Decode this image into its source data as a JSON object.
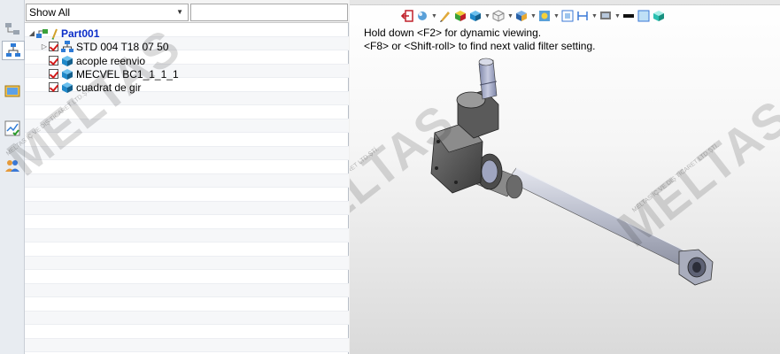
{
  "tree_panel": {
    "filter_select": "Show All",
    "filter_input": "",
    "root": {
      "label": "Part001",
      "expanded": true
    },
    "children": [
      {
        "label": "STD 004 T18 07 50",
        "checked": true,
        "icon": "assembly-icon",
        "has_children": true
      },
      {
        "label": "acople reenvio",
        "checked": true,
        "icon": "part-cube-icon",
        "has_children": false
      },
      {
        "label": "MECVEL BC1_1_1_1",
        "checked": true,
        "icon": "part-cube-icon",
        "has_children": false
      },
      {
        "label": "cuadrat de gir",
        "checked": true,
        "icon": "part-cube-icon",
        "has_children": false
      }
    ]
  },
  "viewport": {
    "hint_line_1": "Hold down <F2> for dynamic viewing.",
    "hint_line_2": "<F8> or <Shift-roll> to find next valid filter setting."
  },
  "left_strip": {
    "icons": [
      "structure-tree-icon",
      "assembly-tree-icon",
      "image-icon",
      "chart-check-icon",
      "users-icon"
    ]
  },
  "watermark": {
    "brand": "MELTAS",
    "tagline": "MELTAS İÇ VE DIŞ TİCARET LTD.ŞTİ."
  },
  "colors": {
    "root_label": "#0a2dc8",
    "checkbox_mark": "#d21a1a",
    "part_icon": "#1f88c9"
  }
}
